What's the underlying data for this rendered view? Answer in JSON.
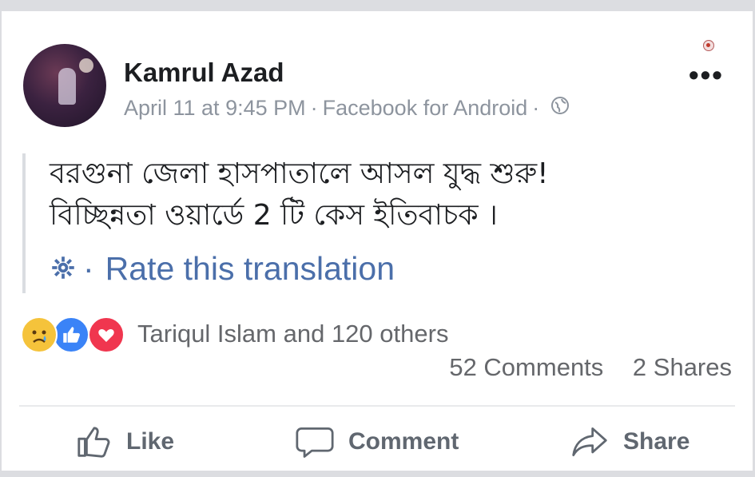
{
  "post": {
    "author": "Kamrul Azad",
    "date": "April 11 at 9:45 PM",
    "separator": "·",
    "source": "Facebook for Android",
    "privacy_icon": "globe-icon",
    "more_icon": "more-options-icon",
    "text_line1": "বরগুনা জেলা হাসপাতালে আসল যুদ্ধ শুরু!",
    "text_line2": "বিচ্ছিন্নতা ওয়ার্ডে 2 টি কেস ইতিবাচক ।",
    "rate_translation": "Rate this translation"
  },
  "reactions": {
    "icons": [
      "sad-reaction-icon",
      "like-reaction-icon",
      "love-reaction-icon"
    ],
    "summary": "Tariqul Islam and 120 others",
    "comments": "52 Comments",
    "shares": "2 Shares"
  },
  "actions": {
    "like": "Like",
    "comment": "Comment",
    "share": "Share"
  },
  "colors": {
    "link_blue": "#4b6faa",
    "like_blue": "#3a83f7",
    "love_red": "#f0364f",
    "sad_yellow": "#f5c33b",
    "muted_text": "#8d949e"
  }
}
